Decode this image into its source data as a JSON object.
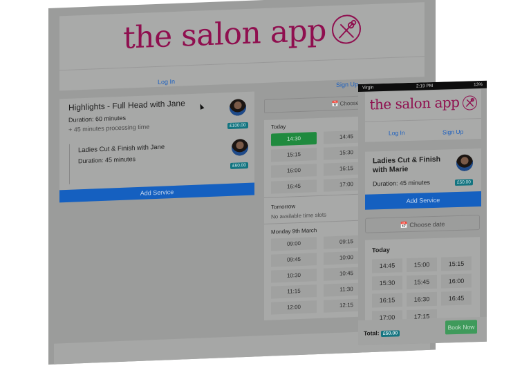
{
  "brand": {
    "name": "the salon app",
    "color": "#8f0f4f",
    "icon": "scissors-icon"
  },
  "desktop": {
    "nav": {
      "login": "Log In",
      "signup": "Sign Up"
    },
    "services": [
      {
        "title": "Highlights - Full Head with Jane",
        "duration": "Duration: 60 minutes",
        "processing": "+ 45 minutes processing time",
        "price": "£100.00"
      },
      {
        "title": "Ladies Cut & Finish with Jane",
        "duration": "Duration: 45 minutes",
        "price": "£60.00"
      }
    ],
    "add_service": "Add Service",
    "choose_date": "Choose date",
    "slots": {
      "today_label": "Today",
      "today": [
        "14:30",
        "14:45",
        "15:15",
        "15:30",
        "16:00",
        "16:15",
        "16:45",
        "17:00"
      ],
      "selected": "14:30",
      "tomorrow_label": "Tomorrow",
      "tomorrow_empty": "No available time slots",
      "monday_label": "Monday 9th March",
      "monday": [
        "09:00",
        "09:15",
        "09:45",
        "10:00",
        "10:30",
        "10:45",
        "11:15",
        "11:30",
        "12:00",
        "12:15"
      ]
    }
  },
  "phone": {
    "status": {
      "carrier": "Virgin",
      "time": "2:19 PM",
      "battery": "13%"
    },
    "nav": {
      "login": "Log In",
      "signup": "Sign Up"
    },
    "service": {
      "title": "Ladies Cut & Finish with Marie",
      "duration": "Duration: 45 minutes",
      "price": "£50.00"
    },
    "add_service": "Add Service",
    "choose_date": "Choose date",
    "today_label": "Today",
    "today": [
      "14:45",
      "15:00",
      "15:15",
      "15:30",
      "15:45",
      "16:00",
      "16:15",
      "16:30",
      "16:45",
      "17:00",
      "17:15"
    ],
    "total_label": "Total:",
    "total": "£50.00",
    "book_now": "Book Now"
  }
}
